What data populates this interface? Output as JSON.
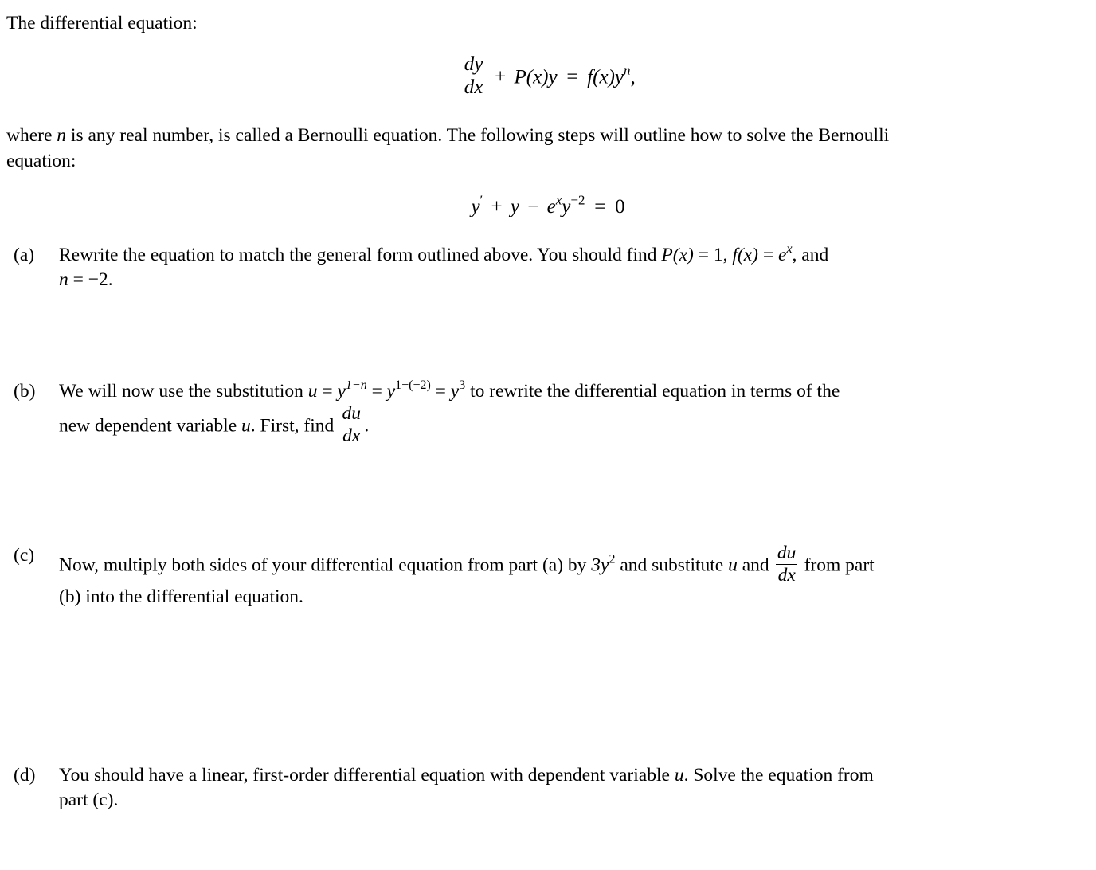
{
  "document": {
    "type": "math-worksheet",
    "topic": "Bernoulli equation",
    "background_color": "#ffffff",
    "text_color": "#000000"
  },
  "intro": {
    "lead": "The differential equation:",
    "equation": {
      "numerator": "dy",
      "denominator": "dx",
      "plus": "+",
      "p_term": "P(x)y",
      "equals": "=",
      "rhs": "f(x)y",
      "rhs_exponent": "n",
      "trailing_comma": ","
    },
    "after_line1": "where",
    "after_var": "n",
    "after_line1b": "is any real number, is called a Bernoulli equation.  The following steps will outline how to solve the Bernoulli",
    "after_line2": "equation:"
  },
  "problem_equation": {
    "y_prime": "y",
    "prime_mark": "′",
    "plus": "+",
    "y": "y",
    "minus": "−",
    "e": "e",
    "e_exp": "x",
    "y2": "y",
    "y2_exp": "−2",
    "equals": "=",
    "zero": "0"
  },
  "parts": [
    {
      "label": "(a)",
      "line1_pre": "Rewrite the equation to match the general form outlined above.  You should find ",
      "px": "P(x)",
      "px_eq": " = 1, ",
      "fx": "f(x)",
      "fx_eq": " = ",
      "e": "e",
      "e_exp": "x",
      "line1_post": ", and",
      "line2_n": "n",
      "line2_rest": " = −2."
    },
    {
      "label": "(b)",
      "line1_pre": "We will now use the substitution ",
      "u": "u",
      "eq1": " = ",
      "y1": "y",
      "y1_exp": "1−n",
      "eq2": " = ",
      "y2": "y",
      "y2_exp": "1−(−2)",
      "eq3": " = ",
      "y3": "y",
      "y3_exp": "3",
      "line1_post": " to rewrite the differential equation in terms of the",
      "line2_pre": "new dependent variable ",
      "u2": "u",
      "line2_mid": ".  First, find ",
      "frac_num": "du",
      "frac_den": "dx",
      "line2_post": "."
    },
    {
      "label": "(c)",
      "line1_pre": "Now, multiply both sides of your differential equation from part (a) by ",
      "coef": "3y",
      "coef_exp": "2",
      "line1_mid": " and substitute ",
      "u": "u",
      "line1_mid2": " and ",
      "frac_num": "du",
      "frac_den": "dx",
      "line1_post": " from part",
      "line2": "(b) into the differential equation."
    },
    {
      "label": "(d)",
      "line1_pre": "You should have a linear, first-order differential equation with dependent variable ",
      "u": "u",
      "line1_post": ".  Solve the equation from",
      "line2": "part (c)."
    }
  ]
}
